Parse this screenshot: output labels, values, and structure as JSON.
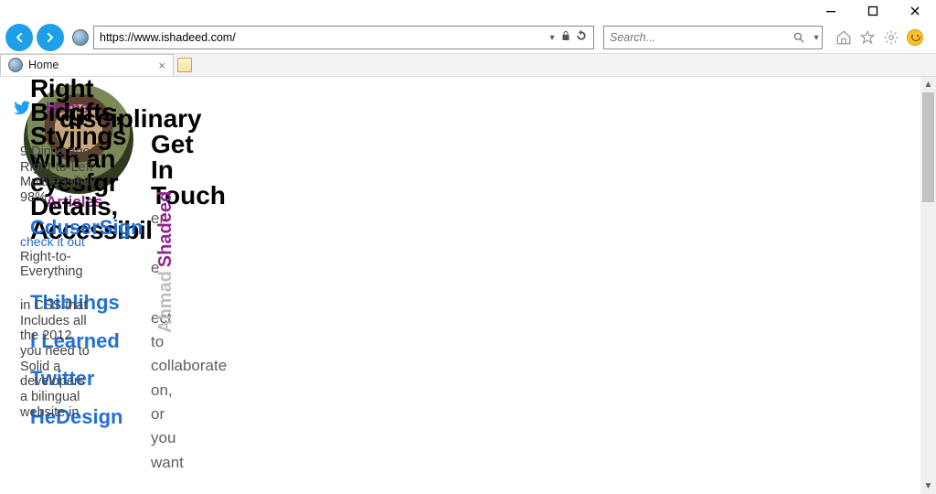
{
  "window": {
    "minimize": "—",
    "maximize": "□",
    "close": "✕"
  },
  "toolbar": {
    "url": "https://www.ishadeed.com/",
    "search_placeholder": "Search..."
  },
  "tab": {
    "title": "Home"
  },
  "page": {
    "nav": {
      "home": "Home",
      "articles": "Articles"
    },
    "overlap": {
      "l1": "Right",
      "l2": "Bidgfts,",
      "l3": "Styjjngs",
      "l4": "with an",
      "l5": "eyesfgr",
      "l6": "Details,",
      "l7": "Accessibil"
    },
    "head2": {
      "l1": "disciplinary",
      "l2": "Get",
      "l3": "In",
      "l4": "Touch"
    },
    "blue": {
      "l1": "CduserSign",
      "check": "check it out",
      "l2": "Thiblihgs",
      "l3": "I Learned",
      "l4": "Twitter",
      "l5": "HeDesign"
    },
    "thin": {
      "t1": "9 Dincs ago",
      "t2": "Right-to-Left",
      "t3": "Multi-essibili",
      "t4": "98%",
      "t5": "Right-to-",
      "t6": "Everything",
      "t7": "in CSS that",
      "t8": "Includes all",
      "t9": "the 2012",
      "t10": "you need to",
      "t11": "Solid a",
      "t12": "developers",
      "t13": "a bilingual",
      "t14": "website in"
    },
    "rightcol": {
      "r1": "er",
      "r2": "e",
      "r3": "ect",
      "r4": "to",
      "r5": "collaborate",
      "r6": "on,",
      "r7": "or",
      "r8": "you",
      "r9": "want"
    },
    "rotated": {
      "first": "Ahmad",
      "last": "Shadeed"
    }
  }
}
